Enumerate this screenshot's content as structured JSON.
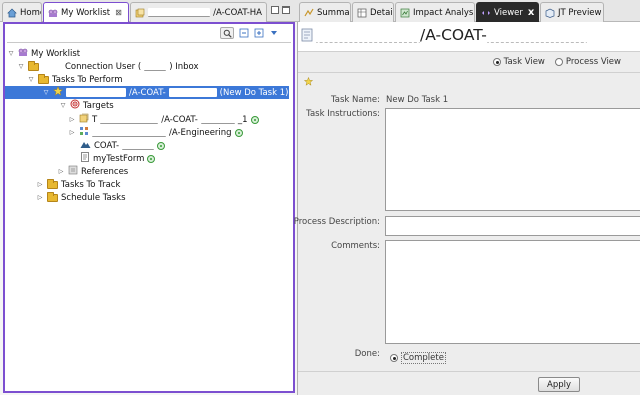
{
  "left_tabs": [
    {
      "label": "Home",
      "icon": "home-icon"
    },
    {
      "label": "My Worklist",
      "icon": "worklist-icon",
      "close": "⊠"
    },
    {
      "label": "/A-COAT-HA",
      "icon": "item-revision-icon"
    }
  ],
  "tree": {
    "root": "My Worklist",
    "inbox_prefix": "Connection User (",
    "inbox_suffix": ") Inbox",
    "tasks_to_perform": "Tasks To Perform",
    "selected_task_text": "/A-COAT-",
    "selected_task_suffix": "(New Do Task 1)",
    "targets": "Targets",
    "target1_prefix": "T",
    "target1_text": "/A-COAT-",
    "target1_tail": "_1",
    "target2_text": "/A-Engineering",
    "target3_text": "COAT-",
    "target4_text": "myTestForm",
    "references": "References",
    "tasks_to_track": "Tasks To Track",
    "schedule_tasks": "Schedule Tasks"
  },
  "right_tabs": [
    {
      "label": "Summary"
    },
    {
      "label": "Details"
    },
    {
      "label": "Impact Analysis"
    },
    {
      "label": "Viewer",
      "close": "x"
    },
    {
      "label": "JT Preview"
    }
  ],
  "header": {
    "title": "/A-COAT-"
  },
  "view_toggle": {
    "task_view": "Task View",
    "process_view": "Process View",
    "selected": "task_view"
  },
  "form": {
    "task_name_label": "Task Name:",
    "task_name_value": "New Do Task 1",
    "instructions_label": "Task Instructions:",
    "process_desc_label": "Process Description:",
    "comments_label": "Comments:",
    "done_label": "Done:",
    "complete_label": "Complete",
    "apply_label": "Apply"
  },
  "colors": {
    "accent_purple": "#7c4fd0",
    "selection_blue": "#3c78d8",
    "viewer_tab_dark": "#2a2a2a"
  }
}
